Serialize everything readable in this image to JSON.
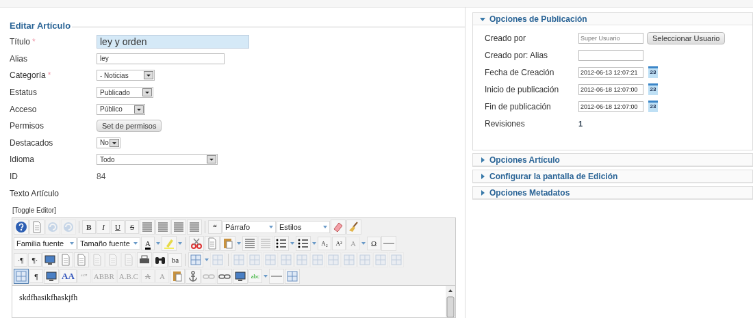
{
  "form": {
    "legend": "Editar Artículo",
    "fields": [
      {
        "label": "Título",
        "asterisk": "*",
        "kind": "text",
        "value": "ley y orden",
        "focused": true
      },
      {
        "label": "Alias",
        "kind": "text",
        "value": "ley",
        "focused": false
      },
      {
        "label": "Categoría",
        "asterisk": "*",
        "kind": "select",
        "value": "- Noticias"
      },
      {
        "label": "Estatus",
        "kind": "select",
        "value": "Publicado"
      },
      {
        "label": "Acceso",
        "kind": "select",
        "value": "Público"
      },
      {
        "label": "Permisos",
        "kind": "button",
        "value": "Set de permisos"
      },
      {
        "label": "Destacados",
        "kind": "select",
        "value": "No"
      },
      {
        "label": "Idioma",
        "kind": "select",
        "value": "Todo"
      },
      {
        "label": "ID",
        "kind": "plain",
        "value": "84"
      },
      {
        "label": "Texto Artículo",
        "kind": "none"
      }
    ]
  },
  "editor": {
    "toggle": "[Toggle Editor]",
    "toolbar": [
      [
        {
          "kind": "help"
        },
        {
          "kind": "doc"
        },
        {
          "kind": "undo",
          "disabled": true
        },
        {
          "kind": "redo",
          "disabled": true
        },
        {
          "kind": "sep"
        },
        {
          "kind": "glyph",
          "label": "B"
        },
        {
          "kind": "glyph",
          "label": "I"
        },
        {
          "kind": "glyph",
          "label": "U"
        },
        {
          "kind": "glyph",
          "label": "S"
        },
        {
          "kind": "lines"
        },
        {
          "kind": "lines"
        },
        {
          "kind": "lines"
        },
        {
          "kind": "lines"
        },
        {
          "kind": "sep"
        },
        {
          "kind": "glyph",
          "label": "“"
        },
        {
          "kind": "select",
          "value": "Párrafo"
        },
        {
          "kind": "select",
          "value": "Estilos"
        },
        {
          "kind": "eraser"
        },
        {
          "kind": "broom"
        }
      ],
      [
        {
          "kind": "select",
          "value": "Familia fuente"
        },
        {
          "kind": "select",
          "value": "Tamaño fuente"
        },
        {
          "kind": "glyph",
          "label": "A"
        },
        {
          "kind": "drop"
        },
        {
          "kind": "marker"
        },
        {
          "kind": "drop"
        },
        {
          "kind": "sep"
        },
        {
          "kind": "cut"
        },
        {
          "kind": "doc"
        },
        {
          "kind": "paste"
        },
        {
          "kind": "drop"
        },
        {
          "kind": "lines"
        },
        {
          "kind": "lines",
          "disabled": true
        },
        {
          "kind": "list"
        },
        {
          "kind": "drop"
        },
        {
          "kind": "list"
        },
        {
          "kind": "drop"
        },
        {
          "kind": "glyph",
          "label": "A₂"
        },
        {
          "kind": "glyph",
          "label": "A²"
        },
        {
          "kind": "glyph",
          "label": "A",
          "disabled": true
        },
        {
          "kind": "drop"
        },
        {
          "kind": "glyph",
          "label": "Ω"
        },
        {
          "kind": "rule"
        }
      ],
      [
        {
          "kind": "glyph",
          "label": "·¶"
        },
        {
          "kind": "glyph",
          "label": "¶·"
        },
        {
          "kind": "monitor"
        },
        {
          "kind": "doc"
        },
        {
          "kind": "doc"
        },
        {
          "kind": "doc",
          "disabled": true
        },
        {
          "kind": "doc",
          "disabled": true
        },
        {
          "kind": "doc",
          "disabled": true
        },
        {
          "kind": "printer"
        },
        {
          "kind": "binoculars"
        },
        {
          "kind": "glyph",
          "label": "ba"
        },
        {
          "kind": "sep"
        },
        {
          "kind": "table"
        },
        {
          "kind": "drop"
        },
        {
          "kind": "table",
          "disabled": true
        },
        {
          "kind": "sep"
        },
        {
          "kind": "table",
          "disabled": true
        },
        {
          "kind": "table",
          "disabled": true
        },
        {
          "kind": "table",
          "disabled": true
        },
        {
          "kind": "table",
          "disabled": true
        },
        {
          "kind": "table",
          "disabled": true
        },
        {
          "kind": "table",
          "disabled": true
        },
        {
          "kind": "table",
          "disabled": true
        },
        {
          "kind": "table",
          "disabled": true
        },
        {
          "kind": "table",
          "disabled": true
        },
        {
          "kind": "table",
          "disabled": true
        },
        {
          "kind": "table",
          "disabled": true
        }
      ],
      [
        {
          "kind": "table",
          "active": true
        },
        {
          "kind": "glyph",
          "label": "¶"
        },
        {
          "kind": "monitor"
        },
        {
          "kind": "glyph",
          "label": "AA"
        },
        {
          "kind": "glyph",
          "label": "“”",
          "disabled": true
        },
        {
          "kind": "glyph",
          "label": "ABBR",
          "disabled": true
        },
        {
          "kind": "glyph",
          "label": "A.B.C",
          "disabled": true
        },
        {
          "kind": "glyph",
          "label": "A",
          "disabled": true
        },
        {
          "kind": "glyph",
          "label": "A",
          "disabled": true
        },
        {
          "kind": "paste"
        },
        {
          "kind": "anchor"
        },
        {
          "kind": "link",
          "disabled": true
        },
        {
          "kind": "link"
        },
        {
          "kind": "monitor"
        },
        {
          "kind": "glyph",
          "label": "abc"
        },
        {
          "kind": "drop"
        },
        {
          "kind": "rule"
        },
        {
          "kind": "table"
        }
      ]
    ],
    "content": "skdfhasikfhaskjfh"
  },
  "panels": [
    {
      "title": "Opciones de Publicación",
      "expanded": true,
      "rows": [
        {
          "label": "Creado por",
          "kind": "user",
          "value": "Super Usuario",
          "button": "Seleccionar Usuario"
        },
        {
          "label": "Creado por: Alias",
          "kind": "text"
        },
        {
          "label": "Fecha de Creación",
          "kind": "date",
          "value": "2012-06-13 12:07:21",
          "calendar": "23"
        },
        {
          "label": "Inicio de publicación",
          "kind": "date",
          "value": "2012-06-18 12:07:00",
          "calendar": "23"
        },
        {
          "label": "Fin de publicación",
          "kind": "date",
          "value": "2012-06-18 12:07:00",
          "calendar": "23"
        },
        {
          "label": "Revisiones",
          "kind": "plain",
          "value": "1"
        }
      ]
    },
    {
      "title": "Opciones Artículo",
      "expanded": false
    },
    {
      "title": "Configurar la pantalla de Edición",
      "expanded": false
    },
    {
      "title": "Opciones Metadatos",
      "expanded": false
    }
  ]
}
